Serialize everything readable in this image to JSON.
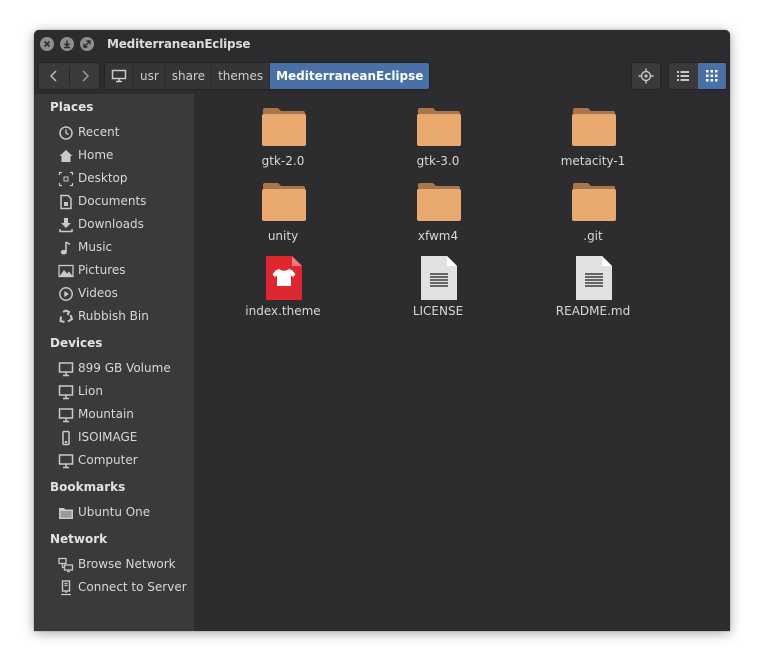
{
  "window": {
    "title": "MediterraneanEclipse"
  },
  "breadcrumb": [
    "usr",
    "share",
    "themes",
    "MediterraneanEclipse"
  ],
  "sidebar": {
    "places": {
      "heading": "Places",
      "items": [
        {
          "label": "Recent",
          "icon": "clock-icon"
        },
        {
          "label": "Home",
          "icon": "home-icon"
        },
        {
          "label": "Desktop",
          "icon": "desktop-icon"
        },
        {
          "label": "Documents",
          "icon": "document-icon"
        },
        {
          "label": "Downloads",
          "icon": "download-icon"
        },
        {
          "label": "Music",
          "icon": "music-icon"
        },
        {
          "label": "Pictures",
          "icon": "picture-icon"
        },
        {
          "label": "Videos",
          "icon": "video-icon"
        },
        {
          "label": "Rubbish Bin",
          "icon": "trash-icon"
        }
      ]
    },
    "devices": {
      "heading": "Devices",
      "items": [
        {
          "label": "899 GB Volume",
          "icon": "computer-icon"
        },
        {
          "label": "Lion",
          "icon": "computer-icon"
        },
        {
          "label": "Mountain",
          "icon": "computer-icon"
        },
        {
          "label": "ISOIMAGE",
          "icon": "usb-drive-icon"
        },
        {
          "label": "Computer",
          "icon": "computer-icon"
        }
      ]
    },
    "bookmarks": {
      "heading": "Bookmarks",
      "items": [
        {
          "label": "Ubuntu One",
          "icon": "folder-icon"
        }
      ]
    },
    "network": {
      "heading": "Network",
      "items": [
        {
          "label": "Browse Network",
          "icon": "network-icon"
        },
        {
          "label": "Connect to Server",
          "icon": "server-icon"
        }
      ]
    }
  },
  "files": [
    {
      "name": "gtk-2.0",
      "type": "folder"
    },
    {
      "name": "gtk-3.0",
      "type": "folder"
    },
    {
      "name": "metacity-1",
      "type": "folder"
    },
    {
      "name": "unity",
      "type": "folder"
    },
    {
      "name": "xfwm4",
      "type": "folder"
    },
    {
      "name": ".git",
      "type": "folder"
    },
    {
      "name": "index.theme",
      "type": "theme-file"
    },
    {
      "name": "LICENSE",
      "type": "text-file"
    },
    {
      "name": "README.md",
      "type": "text-file"
    }
  ],
  "colors": {
    "accent": "#4a70a8",
    "folder": "#e9a96f",
    "folder_tab": "#a9754b",
    "theme_file": "#e0272f"
  }
}
